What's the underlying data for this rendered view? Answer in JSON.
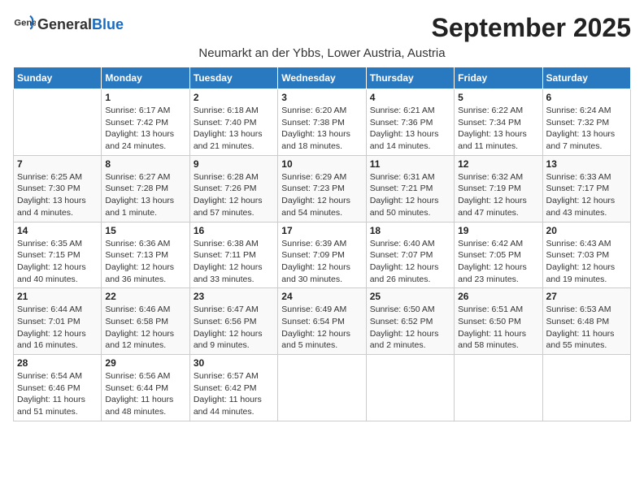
{
  "logo": {
    "general": "General",
    "blue": "Blue"
  },
  "title": "September 2025",
  "location": "Neumarkt an der Ybbs, Lower Austria, Austria",
  "weekdays": [
    "Sunday",
    "Monday",
    "Tuesday",
    "Wednesday",
    "Thursday",
    "Friday",
    "Saturday"
  ],
  "weeks": [
    [
      {
        "day": "",
        "info": ""
      },
      {
        "day": "1",
        "info": "Sunrise: 6:17 AM\nSunset: 7:42 PM\nDaylight: 13 hours\nand 24 minutes."
      },
      {
        "day": "2",
        "info": "Sunrise: 6:18 AM\nSunset: 7:40 PM\nDaylight: 13 hours\nand 21 minutes."
      },
      {
        "day": "3",
        "info": "Sunrise: 6:20 AM\nSunset: 7:38 PM\nDaylight: 13 hours\nand 18 minutes."
      },
      {
        "day": "4",
        "info": "Sunrise: 6:21 AM\nSunset: 7:36 PM\nDaylight: 13 hours\nand 14 minutes."
      },
      {
        "day": "5",
        "info": "Sunrise: 6:22 AM\nSunset: 7:34 PM\nDaylight: 13 hours\nand 11 minutes."
      },
      {
        "day": "6",
        "info": "Sunrise: 6:24 AM\nSunset: 7:32 PM\nDaylight: 13 hours\nand 7 minutes."
      }
    ],
    [
      {
        "day": "7",
        "info": "Sunrise: 6:25 AM\nSunset: 7:30 PM\nDaylight: 13 hours\nand 4 minutes."
      },
      {
        "day": "8",
        "info": "Sunrise: 6:27 AM\nSunset: 7:28 PM\nDaylight: 13 hours\nand 1 minute."
      },
      {
        "day": "9",
        "info": "Sunrise: 6:28 AM\nSunset: 7:26 PM\nDaylight: 12 hours\nand 57 minutes."
      },
      {
        "day": "10",
        "info": "Sunrise: 6:29 AM\nSunset: 7:23 PM\nDaylight: 12 hours\nand 54 minutes."
      },
      {
        "day": "11",
        "info": "Sunrise: 6:31 AM\nSunset: 7:21 PM\nDaylight: 12 hours\nand 50 minutes."
      },
      {
        "day": "12",
        "info": "Sunrise: 6:32 AM\nSunset: 7:19 PM\nDaylight: 12 hours\nand 47 minutes."
      },
      {
        "day": "13",
        "info": "Sunrise: 6:33 AM\nSunset: 7:17 PM\nDaylight: 12 hours\nand 43 minutes."
      }
    ],
    [
      {
        "day": "14",
        "info": "Sunrise: 6:35 AM\nSunset: 7:15 PM\nDaylight: 12 hours\nand 40 minutes."
      },
      {
        "day": "15",
        "info": "Sunrise: 6:36 AM\nSunset: 7:13 PM\nDaylight: 12 hours\nand 36 minutes."
      },
      {
        "day": "16",
        "info": "Sunrise: 6:38 AM\nSunset: 7:11 PM\nDaylight: 12 hours\nand 33 minutes."
      },
      {
        "day": "17",
        "info": "Sunrise: 6:39 AM\nSunset: 7:09 PM\nDaylight: 12 hours\nand 30 minutes."
      },
      {
        "day": "18",
        "info": "Sunrise: 6:40 AM\nSunset: 7:07 PM\nDaylight: 12 hours\nand 26 minutes."
      },
      {
        "day": "19",
        "info": "Sunrise: 6:42 AM\nSunset: 7:05 PM\nDaylight: 12 hours\nand 23 minutes."
      },
      {
        "day": "20",
        "info": "Sunrise: 6:43 AM\nSunset: 7:03 PM\nDaylight: 12 hours\nand 19 minutes."
      }
    ],
    [
      {
        "day": "21",
        "info": "Sunrise: 6:44 AM\nSunset: 7:01 PM\nDaylight: 12 hours\nand 16 minutes."
      },
      {
        "day": "22",
        "info": "Sunrise: 6:46 AM\nSunset: 6:58 PM\nDaylight: 12 hours\nand 12 minutes."
      },
      {
        "day": "23",
        "info": "Sunrise: 6:47 AM\nSunset: 6:56 PM\nDaylight: 12 hours\nand 9 minutes."
      },
      {
        "day": "24",
        "info": "Sunrise: 6:49 AM\nSunset: 6:54 PM\nDaylight: 12 hours\nand 5 minutes."
      },
      {
        "day": "25",
        "info": "Sunrise: 6:50 AM\nSunset: 6:52 PM\nDaylight: 12 hours\nand 2 minutes."
      },
      {
        "day": "26",
        "info": "Sunrise: 6:51 AM\nSunset: 6:50 PM\nDaylight: 11 hours\nand 58 minutes."
      },
      {
        "day": "27",
        "info": "Sunrise: 6:53 AM\nSunset: 6:48 PM\nDaylight: 11 hours\nand 55 minutes."
      }
    ],
    [
      {
        "day": "28",
        "info": "Sunrise: 6:54 AM\nSunset: 6:46 PM\nDaylight: 11 hours\nand 51 minutes."
      },
      {
        "day": "29",
        "info": "Sunrise: 6:56 AM\nSunset: 6:44 PM\nDaylight: 11 hours\nand 48 minutes."
      },
      {
        "day": "30",
        "info": "Sunrise: 6:57 AM\nSunset: 6:42 PM\nDaylight: 11 hours\nand 44 minutes."
      },
      {
        "day": "",
        "info": ""
      },
      {
        "day": "",
        "info": ""
      },
      {
        "day": "",
        "info": ""
      },
      {
        "day": "",
        "info": ""
      }
    ]
  ]
}
